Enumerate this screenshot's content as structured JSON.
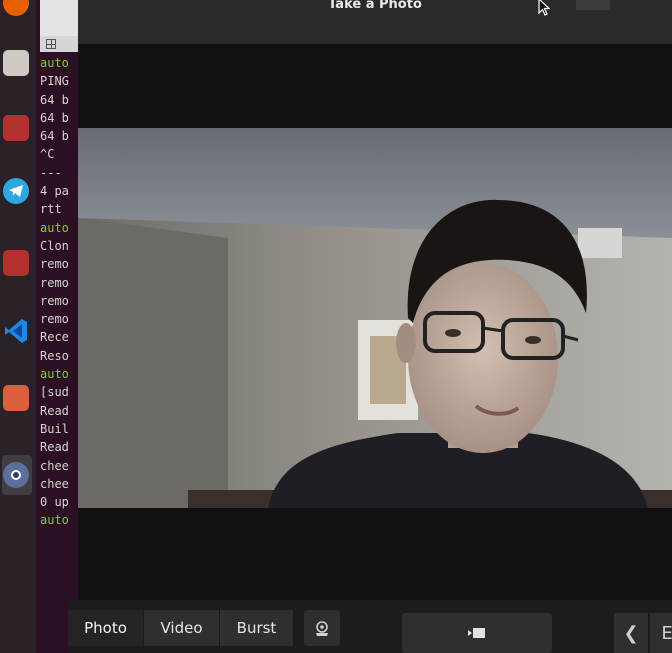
{
  "window": {
    "title": "Take a Photo"
  },
  "terminal": {
    "lines": [
      {
        "text": "auto",
        "color": "green"
      },
      {
        "text": "PING",
        "color": "gray"
      },
      {
        "text": "64 b",
        "color": "gray"
      },
      {
        "text": "64 b",
        "color": "gray"
      },
      {
        "text": "64 b",
        "color": "gray"
      },
      {
        "text": "^C",
        "color": "gray"
      },
      {
        "text": "---",
        "color": "gray"
      },
      {
        "text": "4 pa",
        "color": "gray"
      },
      {
        "text": "rtt",
        "color": "gray"
      },
      {
        "text": "auto",
        "color": "green"
      },
      {
        "text": "Clon",
        "color": "gray"
      },
      {
        "text": "remo",
        "color": "gray"
      },
      {
        "text": "remo",
        "color": "gray"
      },
      {
        "text": "remo",
        "color": "gray"
      },
      {
        "text": "remo",
        "color": "gray"
      },
      {
        "text": "Rece",
        "color": "gray"
      },
      {
        "text": "Reso",
        "color": "gray"
      },
      {
        "text": "auto",
        "color": "green"
      },
      {
        "text": "[sud",
        "color": "gray"
      },
      {
        "text": "Read",
        "color": "gray"
      },
      {
        "text": "Buil",
        "color": "gray"
      },
      {
        "text": "Read",
        "color": "gray"
      },
      {
        "text": "chee",
        "color": "gray"
      },
      {
        "text": "chee",
        "color": "gray"
      },
      {
        "text": "0 up",
        "color": "gray"
      },
      {
        "text": "auto",
        "color": "green"
      }
    ]
  },
  "dock": {
    "items": [
      {
        "name": "firefox-icon",
        "color": "#e66000"
      },
      {
        "name": "files-icon",
        "color": "#cfcac4"
      },
      {
        "name": "app-red-icon",
        "color": "#b3322f"
      },
      {
        "name": "telegram-icon",
        "color": "#2ea6e0"
      },
      {
        "name": "app-red-icon-2",
        "color": "#b3322f"
      },
      {
        "name": "vscode-icon",
        "color": "#1e88e5"
      },
      {
        "name": "software-center-icon",
        "color": "#d9603b"
      },
      {
        "name": "cheese-icon",
        "color": "#5a6f9c"
      }
    ]
  },
  "toolbar": {
    "modes": [
      {
        "label": "Photo",
        "active": true
      },
      {
        "label": "Video",
        "active": false
      },
      {
        "label": "Burst",
        "active": false
      }
    ],
    "effects_icon": "effects-icon",
    "capture_icon": "camera-shutter-icon",
    "prev_label": "❮",
    "next_label": "E"
  },
  "colors": {
    "terminal_bg": "#2c0f22",
    "terminal_green": "#7dcf37",
    "toolbar_bg": "#1c1c1e",
    "button_bg": "#2f2f31"
  }
}
